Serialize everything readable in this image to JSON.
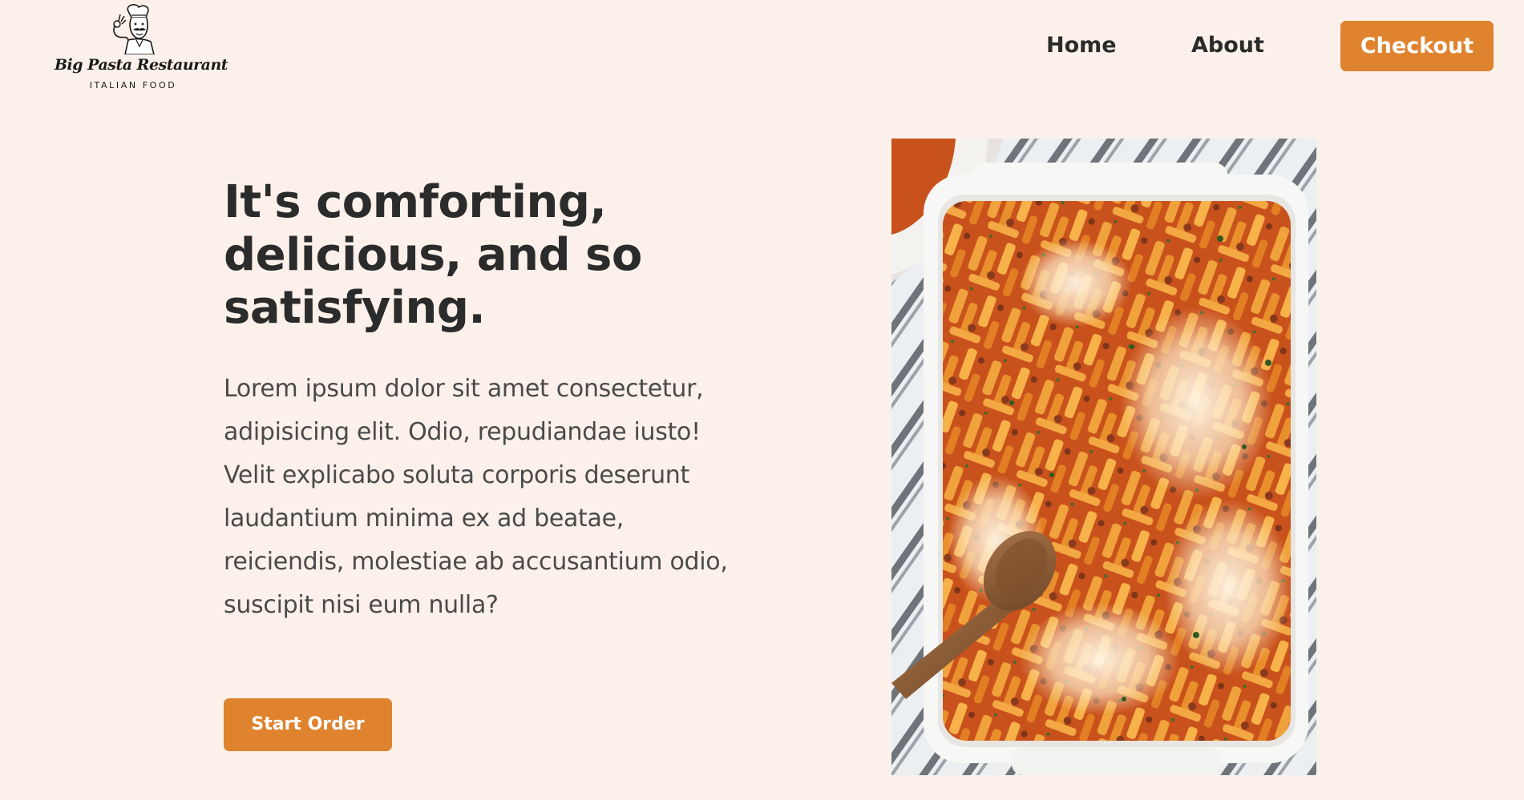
{
  "header": {
    "logo": {
      "brand": "Big Pasta Restaurant",
      "tagline": "ITALIAN FOOD",
      "icon": "chef-icon"
    },
    "nav": {
      "home_label": "Home",
      "about_label": "About"
    },
    "checkout_label": "Checkout"
  },
  "hero": {
    "title": "It's comforting, delicious, and so satisfying.",
    "text": "Lorem ipsum dolor sit amet consectetur, adipisicing elit. Odio, repudiandae iusto! Velit explicabo soluta corporis deserunt laudantium minima ex ad beatae, reiciendis, molestiae ab accusantium odio, suscipit nisi eum nulla?",
    "cta_label": "Start Order",
    "image_subject": "baked-pasta-photo"
  },
  "colors": {
    "background": "#fbf1ea",
    "accent": "#e0832f",
    "heading": "#2b2b2b",
    "body_text": "#4a4a4a",
    "button_text": "#ffffff"
  }
}
